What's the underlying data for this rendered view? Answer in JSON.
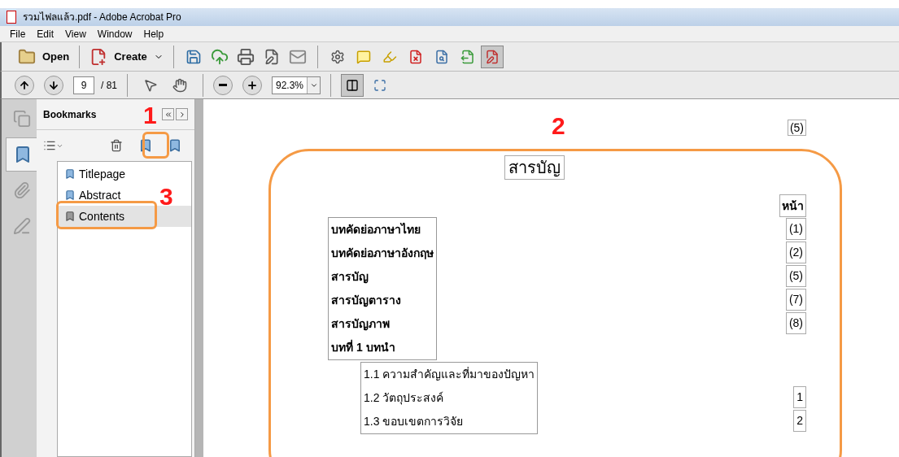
{
  "window": {
    "title": "รวมไฟลแล้ว.pdf - Adobe Acrobat Pro"
  },
  "menu": [
    "File",
    "Edit",
    "View",
    "Window",
    "Help"
  ],
  "toolbar": {
    "open_label": "Open",
    "create_label": "Create"
  },
  "navigation": {
    "page_field": "9",
    "page_total": "/ 81",
    "zoom_field": "92.3%"
  },
  "side_tabs": [
    {
      "kind": "pages",
      "selected": false
    },
    {
      "kind": "bookmarks",
      "selected": true
    },
    {
      "kind": "attachments",
      "selected": false
    },
    {
      "kind": "signatures",
      "selected": false
    }
  ],
  "bookmarks_panel": {
    "title": "Bookmarks",
    "items": [
      {
        "label": "Titlepage",
        "selected": false
      },
      {
        "label": "Abstract",
        "selected": false
      },
      {
        "label": "Contents",
        "selected": true
      }
    ]
  },
  "document": {
    "page_number": "(5)",
    "heading": "สารบัญ",
    "page_column_header": "หน้า",
    "groups": [
      {
        "kind": "chapter",
        "entries": [
          {
            "text": "บทคัดย่อภาษาไทย",
            "page": "(1)"
          },
          {
            "text": "บทคัดย่อภาษาอังกฤษ",
            "page": "(2)"
          },
          {
            "text": "สารบัญ",
            "page": "(5)"
          },
          {
            "text": "สารบัญตาราง",
            "page": "(7)"
          },
          {
            "text": "สารบัญภาพ",
            "page": "(8)"
          },
          {
            "text": "บทที่ 1 บทนำ"
          }
        ]
      },
      {
        "kind": "section",
        "entries": [
          {
            "text": "1.1 ความสำคัญและที่มาของปัญหา"
          },
          {
            "text": "1.2 วัตถุประสงค์",
            "page": "1"
          },
          {
            "text": "1.3 ขอบเขตการวิจัย",
            "page": "2"
          }
        ]
      }
    ]
  },
  "annotations": [
    {
      "label": "1"
    },
    {
      "label": "2"
    },
    {
      "label": "3"
    }
  ]
}
